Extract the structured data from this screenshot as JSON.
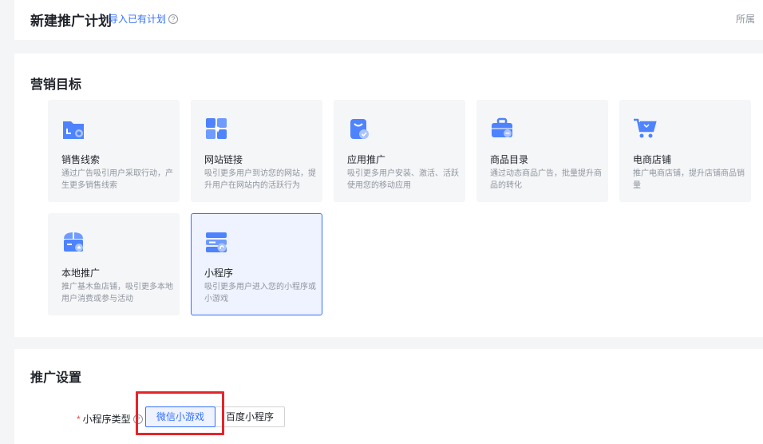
{
  "header": {
    "title": "新建推广计划",
    "import_link": "导入已有计划",
    "help_glyph": "?",
    "right_text": "所属"
  },
  "marketing_goal": {
    "title": "营销目标",
    "cards": [
      {
        "name": "销售线索",
        "desc": "通过广告吸引用户采取行动，产生更多销售线索",
        "icon": "sales-lead-icon"
      },
      {
        "name": "网站链接",
        "desc": "吸引更多用户到访您的网站，提升用户在网站内的活跃行为",
        "icon": "website-link-icon"
      },
      {
        "name": "应用推广",
        "desc": "吸引更多用户安装、激活、活跃使用您的移动应用",
        "icon": "app-promotion-icon"
      },
      {
        "name": "商品目录",
        "desc": "通过动态商品广告，批量提升商品的转化",
        "icon": "product-catalog-icon"
      },
      {
        "name": "电商店铺",
        "desc": "推广电商店铺，提升店铺商品销量",
        "icon": "ecommerce-store-icon"
      },
      {
        "name": "本地推广",
        "desc": "推广基木鱼店铺，吸引更多本地用户消费或参与活动",
        "icon": "local-promotion-icon"
      },
      {
        "name": "小程序",
        "desc": "吸引更多用户进入您的小程序或小游戏",
        "icon": "mini-program-icon",
        "selected": true
      }
    ]
  },
  "promo_settings": {
    "title": "推广设置",
    "field_label": "小程序类型",
    "required_mark": "*",
    "options": [
      "微信小游戏",
      "百度小程序"
    ],
    "selected": "微信小游戏"
  },
  "colors": {
    "accent": "#3370ff",
    "icon_blue": "#4e83fd",
    "highlight": "#e6242a"
  }
}
